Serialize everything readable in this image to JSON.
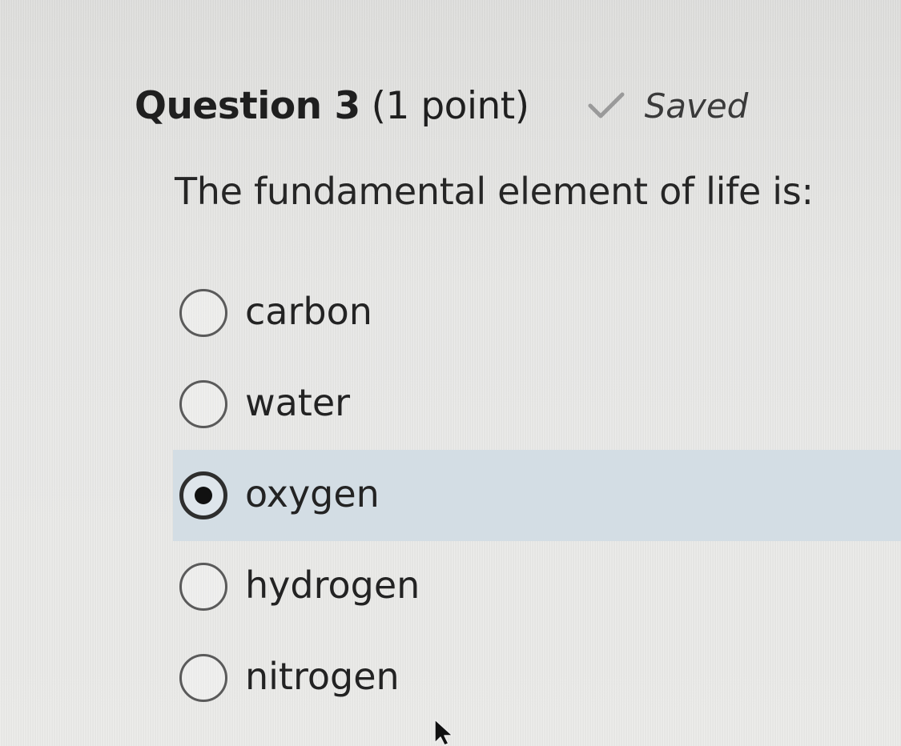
{
  "question": {
    "title": "Question 3",
    "points": "(1 point)",
    "status_icon": "check-icon",
    "status": "Saved"
  },
  "prompt": "The fundamental element of life is:",
  "options": [
    {
      "label": "carbon",
      "selected": false
    },
    {
      "label": "water",
      "selected": false
    },
    {
      "label": "oxygen",
      "selected": true
    },
    {
      "label": "hydrogen",
      "selected": false
    },
    {
      "label": "nitrogen",
      "selected": false
    }
  ],
  "colors": {
    "selected_background": "#d3dde4",
    "check_icon": "#9a9a9a"
  }
}
